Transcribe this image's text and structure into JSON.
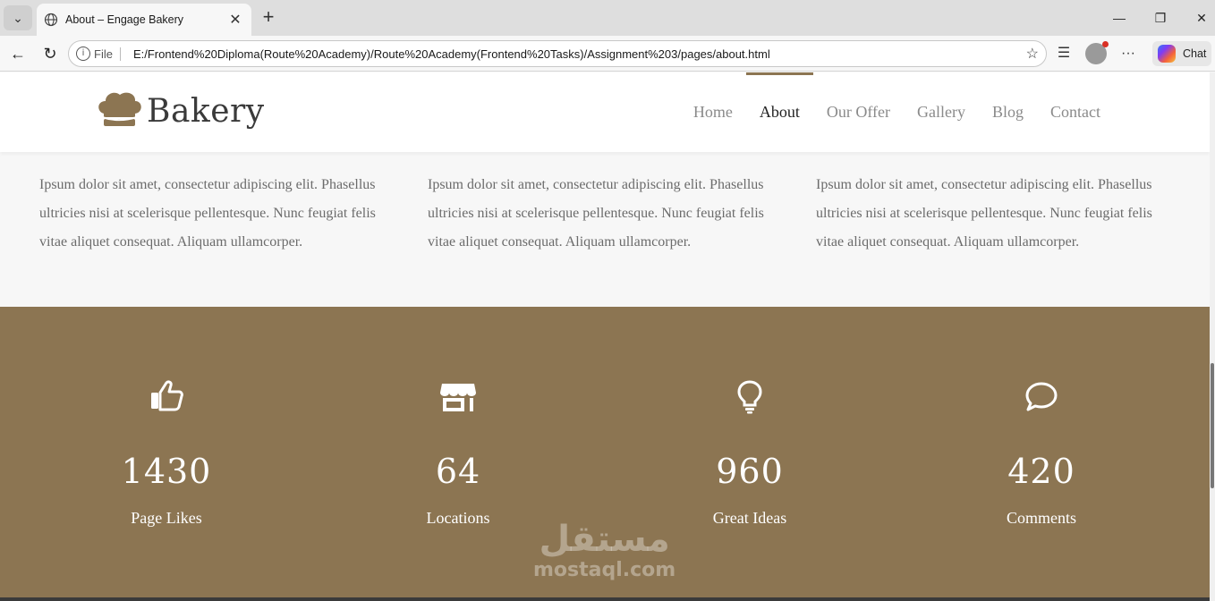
{
  "browser": {
    "tab_title": "About – Engage Bakery",
    "file_label": "File",
    "url": "E:/Frontend%20Diploma(Route%20Academy)/Route%20Academy(Frontend%20Tasks)/Assignment%203/pages/about.html",
    "chat_label": "Chat"
  },
  "site": {
    "brand": "Bakery",
    "nav": [
      "Home",
      "About",
      "Our Offer",
      "Gallery",
      "Blog",
      "Contact"
    ],
    "active_nav": "About"
  },
  "columns": [
    "Ipsum dolor sit amet, consectetur adipiscing elit. Phasellus ultricies nisi at scelerisque pellentesque. Nunc feugiat felis vitae aliquet consequat. Aliquam ullamcorper.",
    "Ipsum dolor sit amet, consectetur adipiscing elit. Phasellus ultricies nisi at scelerisque pellentesque. Nunc feugiat felis vitae aliquet consequat. Aliquam ullamcorper.",
    "Ipsum dolor sit amet, consectetur adipiscing elit. Phasellus ultricies nisi at scelerisque pellentesque. Nunc feugiat felis vitae aliquet consequat. Aliquam ullamcorper."
  ],
  "stats": [
    {
      "icon": "thumbs-up-icon",
      "value": "1430",
      "label": "Page Likes"
    },
    {
      "icon": "store-icon",
      "value": "64",
      "label": "Locations"
    },
    {
      "icon": "lightbulb-icon",
      "value": "960",
      "label": "Great Ideas"
    },
    {
      "icon": "comment-icon",
      "value": "420",
      "label": "Comments"
    }
  ],
  "watermark": {
    "arabic": "مستقل",
    "latin": "mostaql.com"
  },
  "colors": {
    "accent": "#8c7552"
  }
}
